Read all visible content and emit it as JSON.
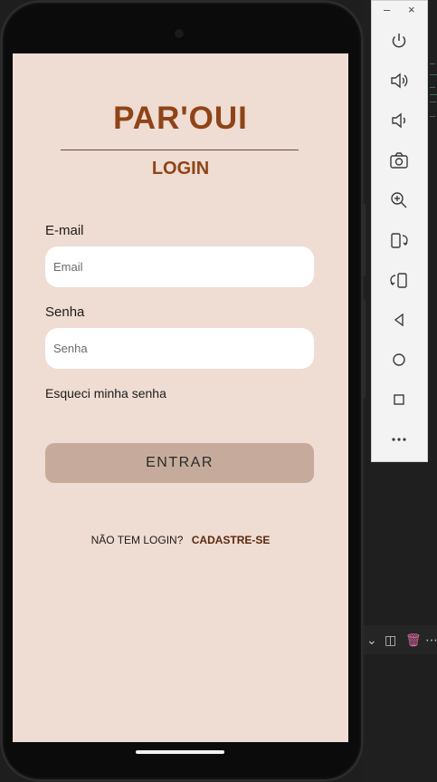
{
  "app": {
    "title": "PAR'OUI",
    "subtitle": "LOGIN",
    "email_label": "E-mail",
    "email_placeholder": "Email",
    "password_label": "Senha",
    "password_placeholder": "Senha",
    "forgot_label": "Esqueci minha senha",
    "enter_label": "ENTRAR",
    "signup_question": "NÃO TEM LOGIN?",
    "signup_link": "CADASTRE-SE"
  },
  "emulator": {
    "minimize_label": "–",
    "close_label": "×",
    "buttons": [
      "power-icon",
      "volume-up-icon",
      "volume-down-icon",
      "camera-icon",
      "zoom-icon",
      "rotate-left-icon",
      "rotate-right-icon",
      "back-icon",
      "home-icon",
      "overview-icon",
      "more-icon"
    ]
  },
  "colors": {
    "background": "#efdcd2",
    "brand": "#8f4417",
    "button": "#c6ab9c"
  }
}
